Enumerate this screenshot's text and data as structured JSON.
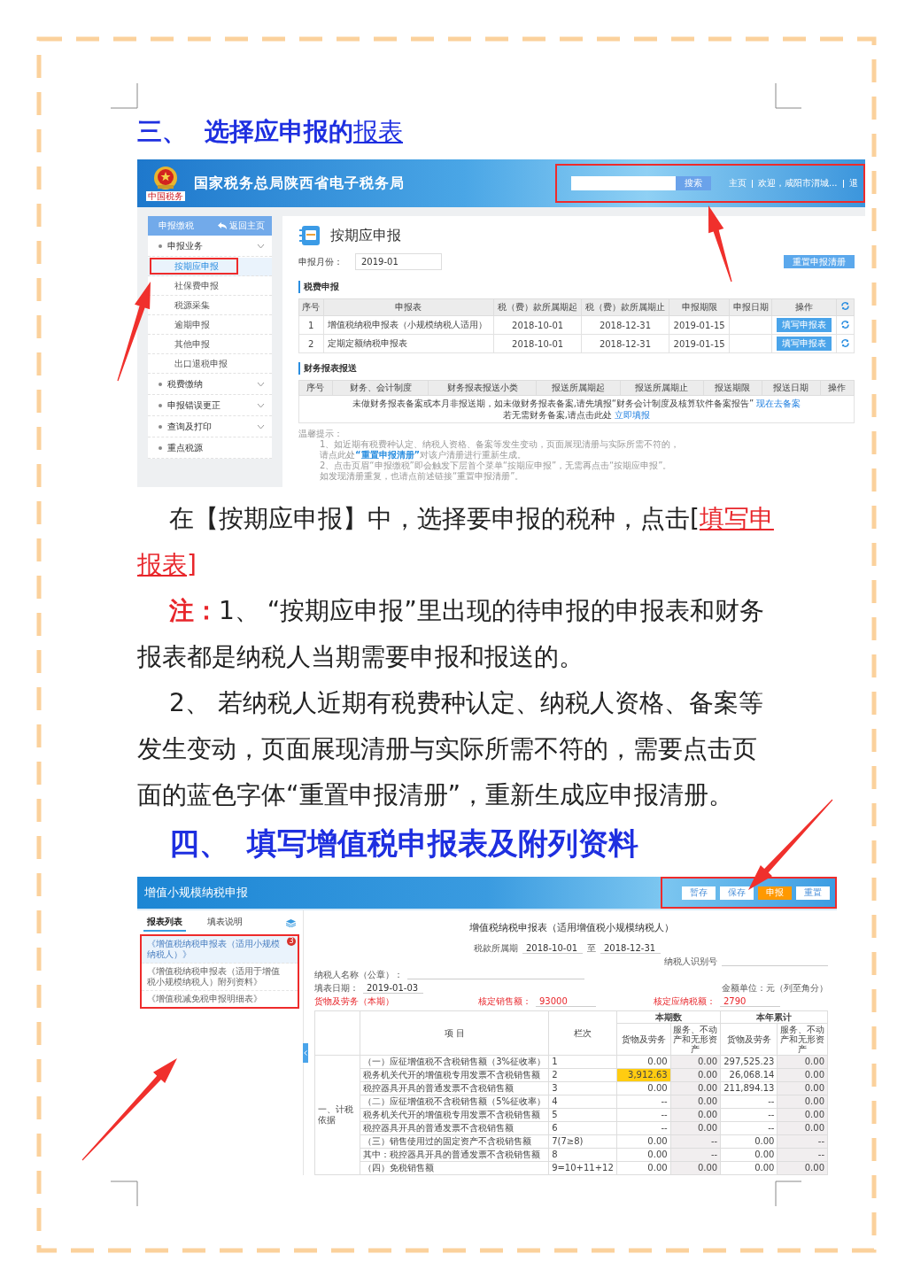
{
  "section_3_heading": {
    "number": "三、",
    "title": "选择应申报的",
    "title_link": "报表"
  },
  "portal": {
    "logo_caption": "中国税务",
    "site_title": "国家税务总局陕西省电子税务局",
    "search_button": "搜索",
    "nav_links": [
      "主页",
      "欢迎，咸阳市渭城...",
      "退"
    ],
    "sidebar": {
      "title": "申报缴税",
      "back_link": "返回主页",
      "items": [
        {
          "label": "申报业务",
          "expandable": true,
          "children": [
            {
              "label": "按期应申报",
              "selected": true
            },
            {
              "label": "社保费申报",
              "selected": false
            },
            {
              "label": "税源采集",
              "selected": false
            },
            {
              "label": "逾期申报",
              "selected": false
            },
            {
              "label": "其他申报",
              "selected": false
            },
            {
              "label": "出口退税申报",
              "selected": false
            }
          ]
        },
        {
          "label": "税费缴纳",
          "expandable": true
        },
        {
          "label": "申报错误更正",
          "expandable": true
        },
        {
          "label": "查询及打印",
          "expandable": true
        },
        {
          "label": "重点税源",
          "expandable": false
        }
      ]
    },
    "page_title": "按期应申报",
    "month_label": "申报月份：",
    "month_value": "2019-01",
    "reset_button": "重置申报清册",
    "tax_section": {
      "title": "税费申报",
      "columns": [
        "序号",
        "申报表",
        "税（费）款所属期起",
        "税（费）款所属期止",
        "申报期限",
        "申报日期",
        "操作"
      ],
      "rows": [
        {
          "index": "1",
          "form": "增值税纳税申报表（小规模纳税人适用）",
          "period_start": "2018-10-01",
          "period_end": "2018-12-31",
          "deadline": "2019-01-15",
          "action": "填写申报表"
        },
        {
          "index": "2",
          "form": "定期定额纳税申报表",
          "period_start": "2018-10-01",
          "period_end": "2018-12-31",
          "deadline": "2019-01-15",
          "action": "填写申报表"
        }
      ]
    },
    "finance_section": {
      "title": "财务报表报送",
      "columns": [
        "序号",
        "财务、会计制度",
        "财务报表报送小类",
        "报送所属期起",
        "报送所属期止",
        "报送期限",
        "报送日期",
        "操作"
      ],
      "notice": [
        {
          "text": "未做财务报表备案或本月非报送期，如未做财务报表备案,请先填报“财务会计制度及核算软件备案报告”",
          "link": "现在去备案"
        },
        {
          "text": "若无需财务备案,请点击此处",
          "link": "立即填报"
        }
      ]
    },
    "tips": {
      "title": "温馨提示：",
      "lines": [
        [
          {
            "kind": "plain",
            "text": "1、如近期有税费种认定、纳税人资格、备案等发生变动，页面展现清册与实际所需不符的，"
          }
        ],
        [
          {
            "kind": "plain",
            "text": "请点此处"
          },
          {
            "kind": "link",
            "text": "“重置申报清册”"
          },
          {
            "kind": "plain",
            "text": "对该户清册进行重新生成。"
          }
        ],
        [
          {
            "kind": "plain",
            "text": "2、点击页眉“申报缴税”即会触发下层首个菜单“按期应申报”，无需再点击“按期应申报”。"
          }
        ],
        [
          {
            "kind": "plain",
            "text": "如发现清册重复，也请点前述链接“重置申报清册”。"
          }
        ]
      ]
    }
  },
  "paragraphs": [
    {
      "segments": [
        {
          "kind": "plain",
          "text": "在【按期应申报】中，选择要申报的税种，点击["
        },
        {
          "kind": "red",
          "text": "填写申报表]"
        }
      ]
    },
    {
      "segments": [
        {
          "kind": "note",
          "text": "注："
        },
        {
          "kind": "plain",
          "text": "1、 “按期应申报”里出现的待申报的申报表和财务报表都是纳税人当期需要申报和报送的。"
        }
      ]
    },
    {
      "segments": [
        {
          "kind": "plain",
          "text": "2、 若纳税人近期有税费种认定、纳税人资格、备案等发生变动，页面展现清册与实际所需不符的，需要点击页面的蓝色字体“重置申报清册”，重新生成应申报清册。"
        }
      ]
    }
  ],
  "section_4_heading": {
    "number": "四、",
    "title": "填写增值税申报表及附列资料"
  },
  "vat_form": {
    "title": "增值小规模纳税申报",
    "buttons": [
      {
        "label": "暂存",
        "primary": false
      },
      {
        "label": "保存",
        "primary": false
      },
      {
        "label": "申报",
        "primary": true
      },
      {
        "label": "重置",
        "primary": false
      }
    ],
    "tabs": [
      {
        "label": "报表列表",
        "selected": true
      },
      {
        "label": "填表说明",
        "selected": false
      }
    ],
    "forms": [
      {
        "label": "《增值税纳税申报表（适用小规模纳税人）》",
        "selected": true,
        "badge": "3"
      },
      {
        "label": "《增值税纳税申报表（适用于增值税小规模纳税人）附列资料》",
        "selected": false
      },
      {
        "label": "《增值税减免税申报明细表》",
        "selected": false
      }
    ],
    "sheet_title": "增值税纳税申报表（适用增值税小规模纳税人）",
    "period_label": "税款所属期",
    "period_start": "2018-10-01",
    "period_to": "至",
    "period_end": "2018-12-31",
    "taxpayer_id_label": "纳税人识别号",
    "taxpayer_name_label": "纳税人名称（公章）：",
    "fill_date_label": "填表日期：",
    "fill_date": "2019-01-03",
    "unit_note": "金额单位：元（列至角分）",
    "category_label": "货物及劳务（本期）",
    "sales_label": "核定销售额：",
    "sales_value": "93000",
    "tax_label": "核定应纳税额：",
    "tax_value": "2790",
    "table": {
      "item_header": "项 目",
      "line_header": "栏次",
      "groups": [
        {
          "label": "本期数",
          "columns": [
            "货物及劳务",
            "服务、不动产和无形资产"
          ]
        },
        {
          "label": "本年累计",
          "columns": [
            "货物及劳务",
            "服务、不动产和无形资产"
          ]
        }
      ],
      "group_label": "一、计税依据",
      "rows": [
        {
          "item": "（一）应征增值税不含税销售额（3%征收率）",
          "line": "1",
          "values": [
            "0.00",
            "0.00",
            "297,525.23",
            "0.00"
          ],
          "highlighted": false
        },
        {
          "item": "税务机关代开的增值税专用发票不含税销售额",
          "line": "2",
          "values": [
            "3,912.63",
            "0.00",
            "26,068.14",
            "0.00"
          ],
          "highlighted": true
        },
        {
          "item": "税控器具开具的普通发票不含税销售额",
          "line": "3",
          "values": [
            "0.00",
            "0.00",
            "211,894.13",
            "0.00"
          ],
          "highlighted": false
        },
        {
          "item": "（二）应征增值税不含税销售额（5%征收率）",
          "line": "4",
          "values": [
            "--",
            "0.00",
            "--",
            "0.00"
          ],
          "highlighted": false
        },
        {
          "item": "税务机关代开的增值税专用发票不含税销售额",
          "line": "5",
          "values": [
            "--",
            "0.00",
            "--",
            "0.00"
          ],
          "highlighted": false
        },
        {
          "item": "税控器具开具的普通发票不含税销售额",
          "line": "6",
          "values": [
            "--",
            "0.00",
            "--",
            "0.00"
          ],
          "highlighted": false
        },
        {
          "item": "（三）销售使用过的固定资产不含税销售额",
          "line": "7(7≥8)",
          "values": [
            "0.00",
            "--",
            "0.00",
            "--"
          ],
          "highlighted": false
        },
        {
          "item": "其中：税控器具开具的普通发票不含税销售额",
          "line": "8",
          "values": [
            "0.00",
            "--",
            "0.00",
            "--"
          ],
          "highlighted": false
        },
        {
          "item": "（四）免税销售额",
          "line": "9=10+11+12",
          "values": [
            "0.00",
            "0.00",
            "0.00",
            "0.00"
          ],
          "highlighted": false
        }
      ]
    }
  }
}
